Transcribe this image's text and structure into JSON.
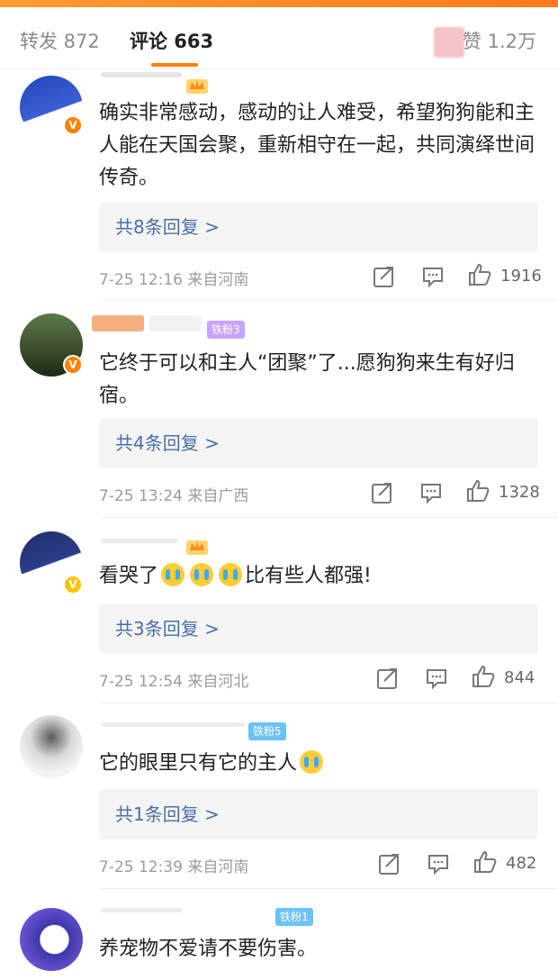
{
  "tabs": {
    "repost": "转发 872",
    "comments": "评论 663",
    "likes": "赞 1.2万"
  },
  "comments": [
    {
      "text": "确实非常感动，感动的让人难受，希望狗狗能和主人能在天国会聚，重新相守在一起，共同演绎世间传奇。",
      "replies": "共8条回复 >",
      "meta": "7-25 12:16 来自河南",
      "likes": "1916",
      "verify": "V"
    },
    {
      "text": "它终于可以和主人“团聚”了...愿狗狗来生有好归宿。",
      "badge": "铁粉3",
      "replies": "共4条回复 >",
      "meta": "7-25 13:24 来自广西",
      "likes": "1328",
      "verify": "V"
    },
    {
      "text_before": "看哭了",
      "text_after": "比有些人都强!",
      "replies": "共3条回复 >",
      "meta": "7-25 12:54 来自河北",
      "likes": "844",
      "verify": "V"
    },
    {
      "text": "它的眼里只有它的主人",
      "badge": "铁粉5",
      "replies": "共1条回复 >",
      "meta": "7-25 12:39 来自河南",
      "likes": "482"
    },
    {
      "text": "养宠物不爱请不要伤害。",
      "badge": "铁粉1"
    }
  ],
  "colors": {
    "accent": "#ff8200",
    "reply_link": "#4a6fa5"
  },
  "icons": [
    "forward-icon",
    "comment-icon",
    "thumb-up-icon",
    "crown-icon",
    "verified-icon",
    "crying-emoji-icon"
  ]
}
